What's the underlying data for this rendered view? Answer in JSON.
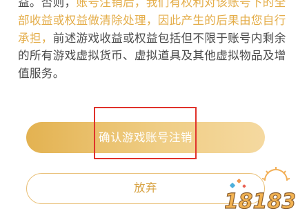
{
  "notice": {
    "line1_prefix": "益。否则，",
    "line1_highlight": "账号注销后，我们有权利对该账号下的全部",
    "line2_highlight": "收益或权益做清除处理，因此产生的后果由您自行承",
    "line3_highlight": "担，",
    "line3_rest": "前述游戏收益或权益包括但不限于账号内剩余的所",
    "line4": "有游戏虚拟货币、虚拟道具及其他虚拟物品及增值服",
    "line5": "务。"
  },
  "buttons": {
    "confirm_label": "确认游戏账号注销",
    "cancel_label": "放弃"
  },
  "watermark": {
    "text": "18183"
  },
  "colors": {
    "highlight_text": "#e4ad49",
    "body_text": "#4a4a4a",
    "confirm_gradient_start": "#e3b251",
    "confirm_gradient_end": "#f5d9a0",
    "annotation_box": "#e0322b",
    "cancel_border": "#e9c078"
  }
}
